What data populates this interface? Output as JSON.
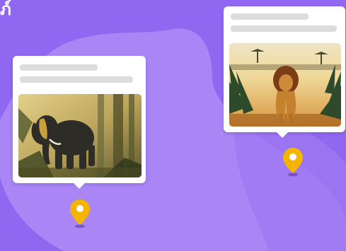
{
  "header": {
    "title_fragment": "ภ์"
  },
  "colors": {
    "background": "#9067f0",
    "blob": "#a985f5",
    "card": "#ffffff",
    "placeholder_bar": "#dcdcdc",
    "pin": "#f5b400"
  },
  "cards": [
    {
      "subject": "elephant",
      "icon": "map-pin-icon"
    },
    {
      "subject": "lion",
      "icon": "map-pin-icon"
    }
  ]
}
